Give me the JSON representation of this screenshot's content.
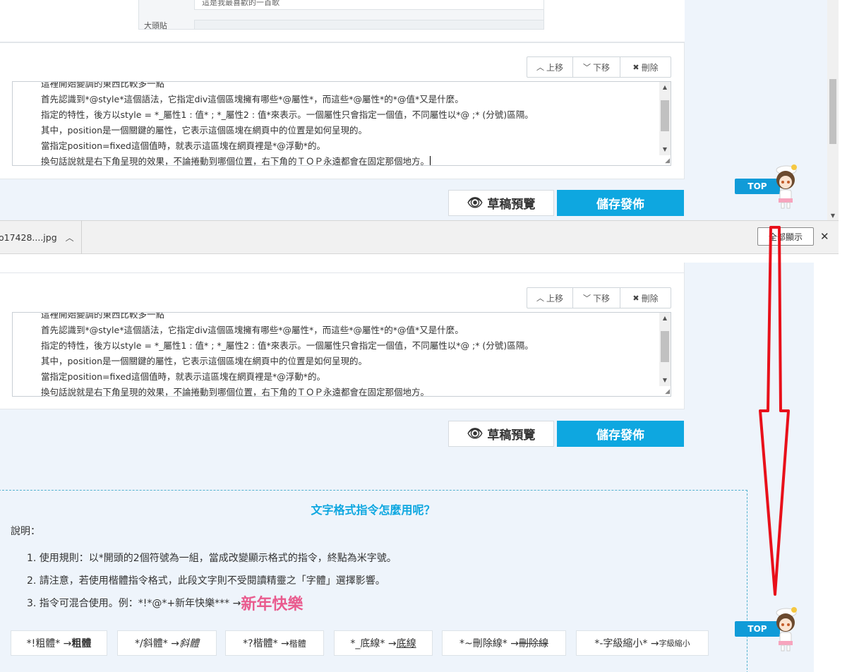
{
  "top_panel": {
    "truncated_input_text": "這是我最喜歡的一首歌",
    "truncated_label": "大頭貼"
  },
  "editor": {
    "move_up_label": "上移",
    "move_down_label": "下移",
    "delete_label": "刪除",
    "lines": [
      "這裡開始變調的東西比較多一點",
      "首先認識到*@style*這個語法，它指定div這個區塊擁有哪些*@屬性*，而這些*@屬性*的*@值*又是什麼。",
      "指定的特性，後方以style = *_屬性1 : 值* ; *_屬性2 : 值*來表示。一個屬性只會指定一個值，不同屬性以*@ ;* (分號)區隔。",
      "其中，position是一個關鍵的屬性，它表示這個區塊在網頁中的位置是如何呈現的。",
      "當指定position=fixed這個值時，就表示這區塊在網頁裡是*@浮動*的。",
      "換句話說就是右下角呈現的效果，不論捲動到哪個位置，右下角的ＴＯＰ永遠都會在固定那個地方。"
    ]
  },
  "actions": {
    "preview_label": "草稿預覽",
    "publish_label": "儲存發佈"
  },
  "top_button_label": "TOP",
  "download_bar": {
    "filename": "o17428....jpg",
    "show_all_label": "全部顯示",
    "close_symbol": "✕"
  },
  "help": {
    "title": "文字格式指令怎麼用呢？",
    "intro": "說明：",
    "rules": [
      "1. 使用規則：以*開頭的2個符號為一組，當成改變顯示格式的指令，終點為米字號。",
      "2. 請注意，若使用楷體指令格式，此段文字則不受閱讀精靈之「字體」選擇影響。",
      "3. 指令可混合使用。例：*!*@*+新年快樂*** → "
    ],
    "rule3_sample": "新年快樂",
    "chips": [
      {
        "code": "*!粗體* → ",
        "result": "粗體"
      },
      {
        "code": "*/斜體* → ",
        "result": "斜體"
      },
      {
        "code": "*?楷體* → ",
        "result": "楷體"
      },
      {
        "code": "*_底線* → ",
        "result": "底線"
      },
      {
        "code": "*~刪除線* → ",
        "result": "刪除線"
      },
      {
        "code": "*-字級縮小* → ",
        "result": "字級縮小"
      }
    ]
  },
  "colors": {
    "accent": "#0ea7e0",
    "arrow": "#e8101a",
    "highlight_pink": "#e95b8e"
  }
}
